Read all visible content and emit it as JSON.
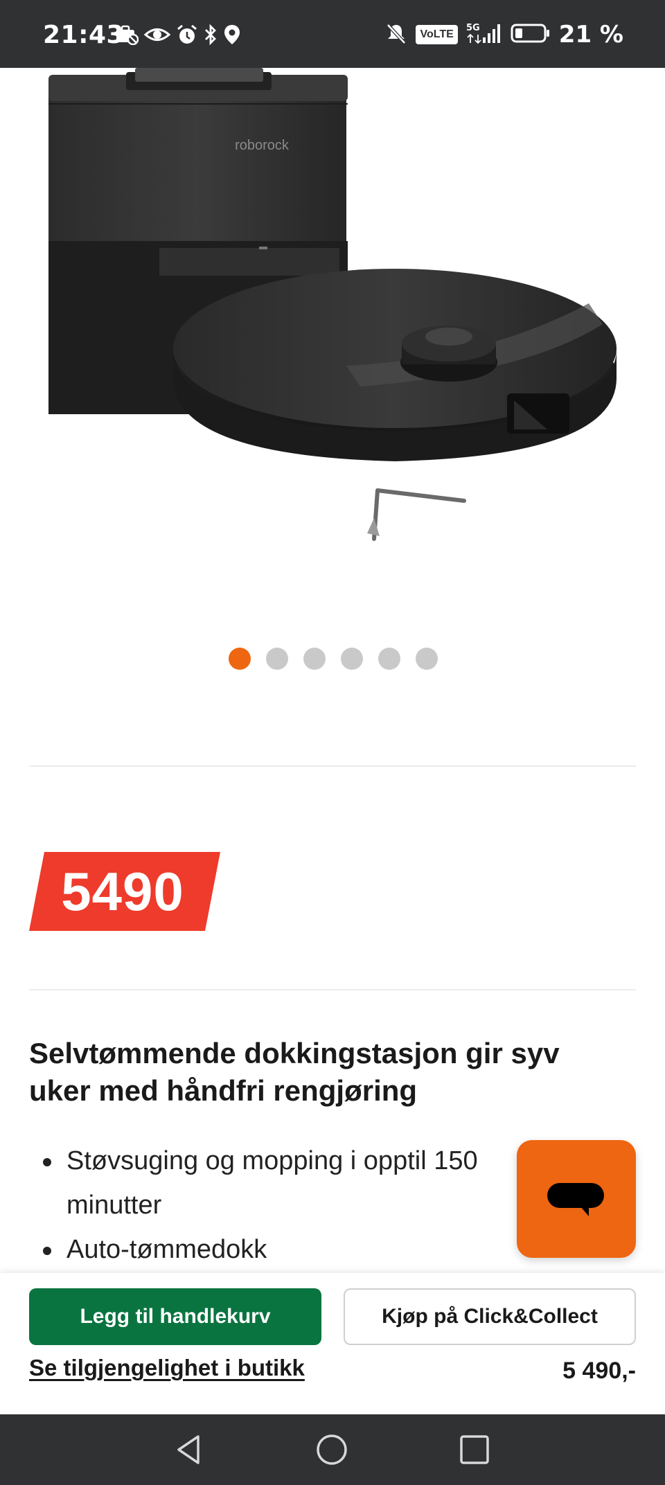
{
  "status_bar": {
    "time": "21:43",
    "battery": "21 %",
    "network_badge": "VoLTE",
    "network_type": "5G",
    "icons_left": [
      "briefcase-icon",
      "eye-icon",
      "alarm-icon",
      "bluetooth-icon",
      "location-icon"
    ],
    "icons_right": [
      "mute-icon",
      "volte-icon",
      "signal-icon",
      "battery-icon"
    ]
  },
  "product": {
    "image_brand_mark": "roborock",
    "carousel": {
      "total": 6,
      "active_index": 0
    },
    "price_tag": "5490",
    "headline": "Selvtømmende dokkingstasjon gir syv uker med håndfri rengjøring",
    "features": [
      "Støvsuging og mopping i opptil 150 minutter",
      "Auto-tømmedokk"
    ]
  },
  "actions": {
    "add_to_cart": "Legg til handlekurv",
    "click_collect": "Kjøp på Click&Collect",
    "availability_link": "Se tilgjengelighet i butikk",
    "price": "5 490,-"
  },
  "colors": {
    "accent_orange": "#ee6611",
    "price_red": "#ee3b2c",
    "cart_green": "#0a7440",
    "system_bar": "#303133"
  }
}
